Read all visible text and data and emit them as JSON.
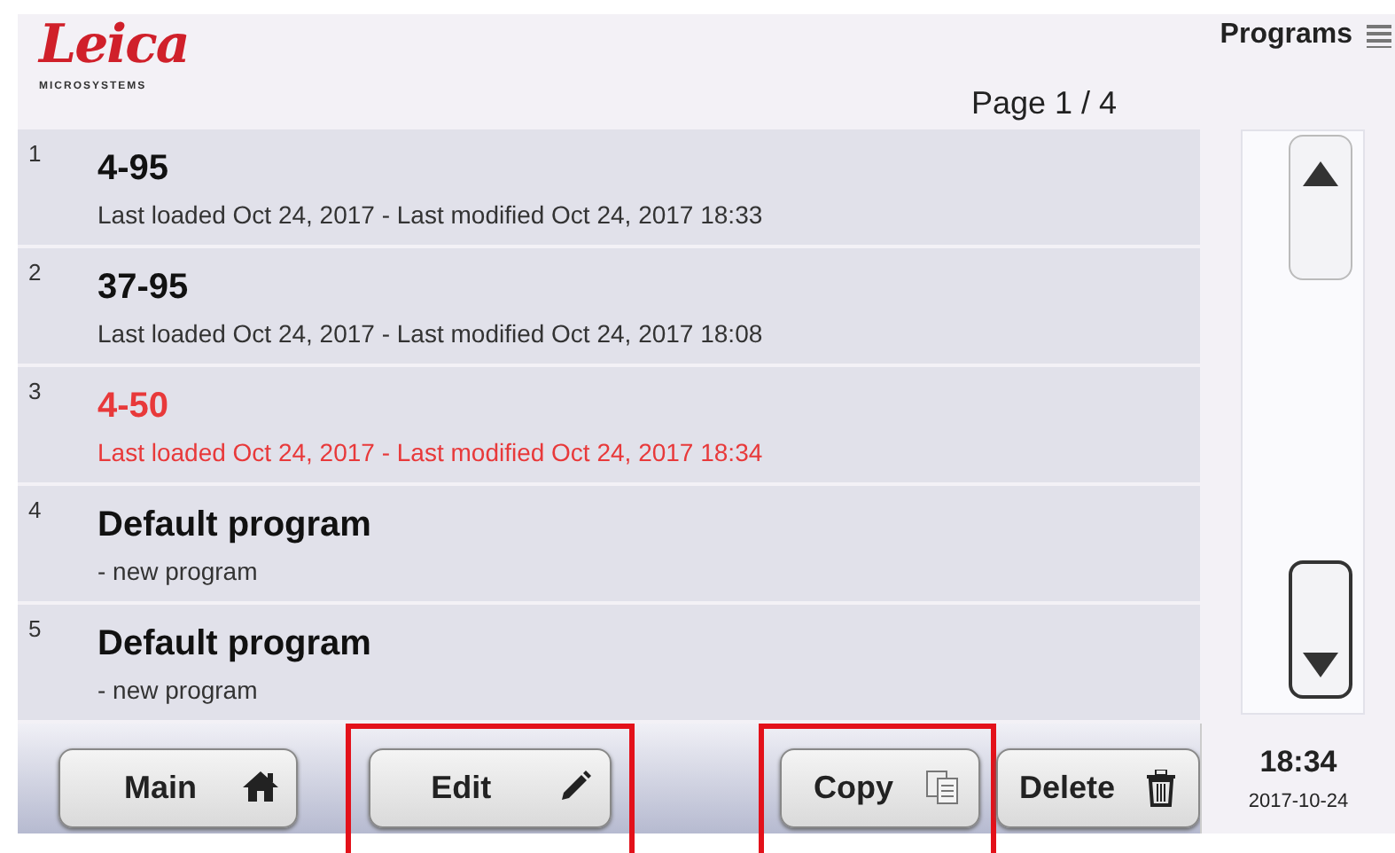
{
  "logo": {
    "wordmark": "Leica",
    "tagline": "MICROSYSTEMS"
  },
  "header": {
    "title": "Programs",
    "page": "Page 1 / 4"
  },
  "programs": [
    {
      "number": "1",
      "name": "4-95",
      "detail": "Last loaded Oct 24, 2017 - Last modified Oct 24, 2017 18:33",
      "selected": false
    },
    {
      "number": "2",
      "name": "37-95",
      "detail": "Last loaded Oct 24, 2017 - Last modified Oct 24, 2017 18:08",
      "selected": false
    },
    {
      "number": "3",
      "name": "4-50",
      "detail": "Last loaded Oct 24, 2017 - Last modified Oct 24, 2017 18:34",
      "selected": true
    },
    {
      "number": "4",
      "name": "Default program",
      "detail": "- new program",
      "selected": false
    },
    {
      "number": "5",
      "name": "Default program",
      "detail": "- new program",
      "selected": false
    }
  ],
  "buttons": [
    {
      "label": "Main",
      "kind": "home",
      "highlighted": false
    },
    {
      "label": "Edit",
      "kind": "pencil",
      "highlighted": true
    },
    {
      "label": "Copy",
      "kind": "copy",
      "highlighted": true
    },
    {
      "label": "Delete",
      "kind": "trash",
      "highlighted": false
    }
  ],
  "status": {
    "time": "18:34",
    "date": "2017-10-24"
  }
}
